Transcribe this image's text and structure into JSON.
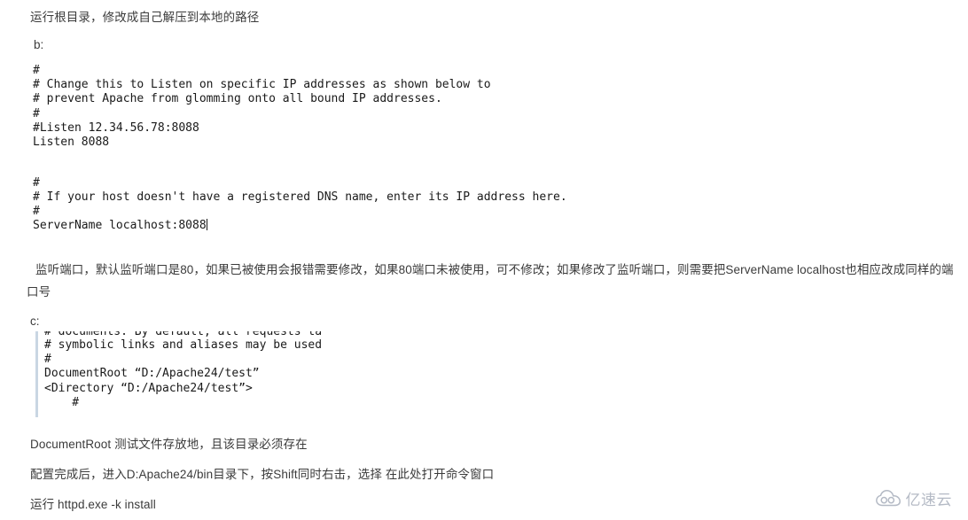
{
  "document": {
    "intro_note": "运行根目录，修改成自己解压到本地的路径",
    "section_b_label": "b:",
    "section_c_label": "c:",
    "code_b": "#\n# Change this to Listen on specific IP addresses as shown below to\n# prevent Apache from glomming onto all bound IP addresses.\n#\n#Listen 12.34.56.78:8088\nListen 8088",
    "code_b2_line1": "#",
    "code_b2_line2": "# If your host doesn't have a registered DNS name, enter its IP address here.",
    "code_b2_line3": "#",
    "code_b2_line4": "ServerName localhost:8088",
    "note_listen_port": "监听端口，默认监听端口是80，如果已被使用会报错需要修改，如果80端口未被使用，可不修改；如果修改了监听端口，则需要把ServerName localhost也相应改成同样的端 口号",
    "code_c_clipped_line": "# documents. By default, all requests ta",
    "code_c": "# symbolic links and aliases may be used\n#\nDocumentRoot “D:/Apache24/test”\n<Directory “D:/Apache24/test”>\n    #",
    "note_documentroot": "DocumentRoot 测试文件存放地，且该目录必须存在",
    "note_after_config": "配置完成后，进入D:Apache24/bin目录下，按Shift同时右击，选择 在此处打开命令窗口",
    "note_run_install": "运行 httpd.exe  -k  install"
  },
  "watermark": {
    "text": "亿速云",
    "icon": "cloud-logo-icon",
    "color": "#a8afbb"
  },
  "colors": {
    "background": "#ffffff",
    "prose_text": "#3b3b3b",
    "code_text": "#1a1a1a",
    "code_border": "#c9d6e3",
    "watermark": "#a8afbb"
  }
}
